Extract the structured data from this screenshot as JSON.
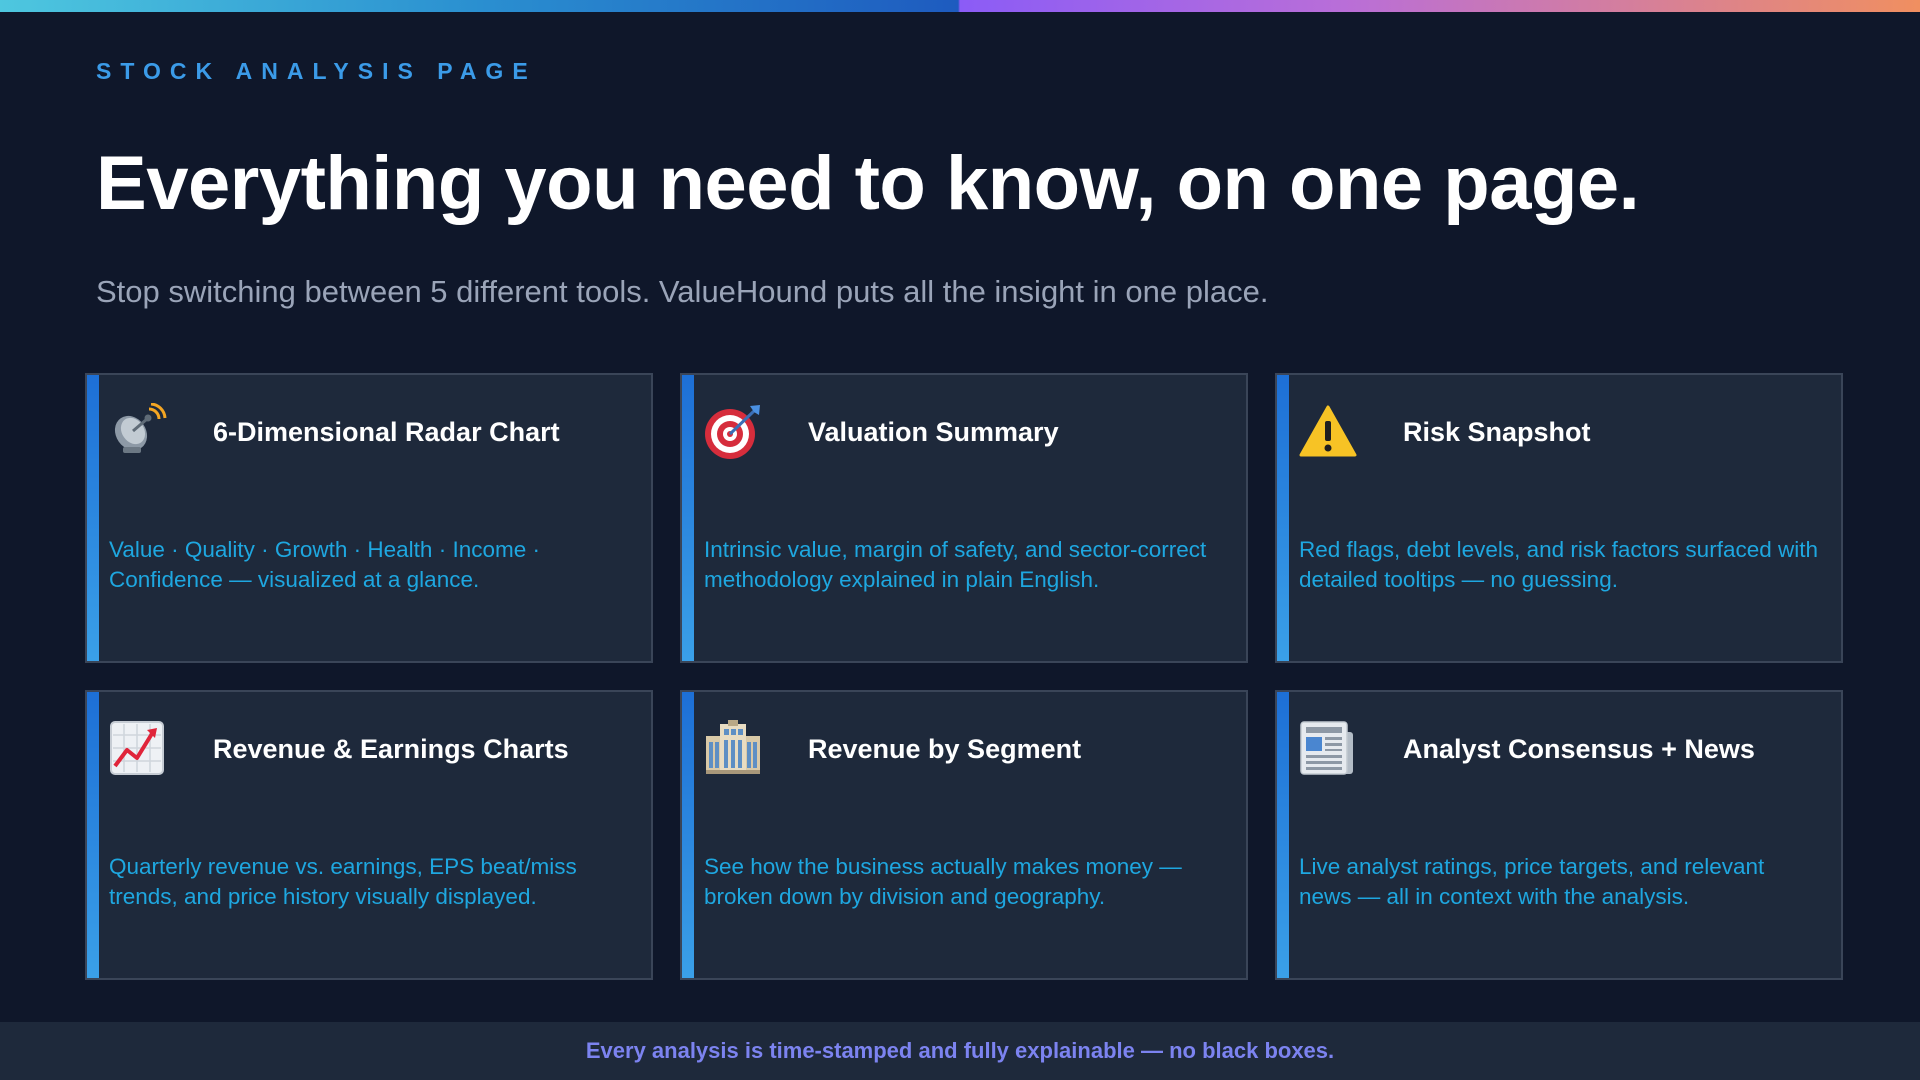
{
  "header": {
    "eyebrow": "STOCK ANALYSIS PAGE",
    "title": "Everything you need to know, on one page.",
    "subtitle": "Stop switching between 5 different tools. ValueHound puts all the insight in one place."
  },
  "cards": [
    {
      "icon": "satellite-dish-icon",
      "title": "6-Dimensional Radar Chart",
      "description": "Value · Quality · Growth · Health · Income · Confidence — visualized at a glance."
    },
    {
      "icon": "target-icon",
      "title": "Valuation Summary",
      "description": "Intrinsic value, margin of safety, and sector-correct methodology explained in plain English."
    },
    {
      "icon": "warning-icon",
      "title": "Risk Snapshot",
      "description": "Red flags, debt levels, and risk factors surfaced with detailed tooltips — no guessing."
    },
    {
      "icon": "chart-increasing-icon",
      "title": "Revenue & Earnings Charts",
      "description": "Quarterly revenue vs. earnings, EPS beat/miss trends, and price history visually displayed."
    },
    {
      "icon": "office-building-icon",
      "title": "Revenue by Segment",
      "description": "See how the business actually makes money — broken down by division and geography."
    },
    {
      "icon": "newspaper-icon",
      "title": "Analyst Consensus + News",
      "description": "Live analyst ratings, price targets, and relevant news — all in context with the analysis."
    }
  ],
  "footer": {
    "text": "Every analysis is time-stamped and fully explainable — no black boxes."
  },
  "colors": {
    "background": "#0f172a",
    "card": "#1e293b",
    "accent_blue": "#3b9be8",
    "description": "#1ea7e0",
    "footer_text": "#7c83f0"
  }
}
